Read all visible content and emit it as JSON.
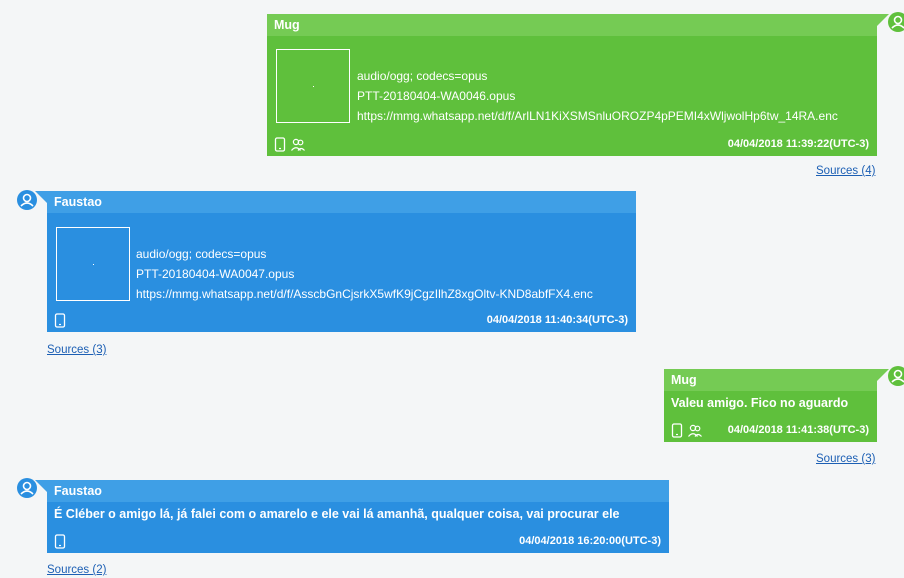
{
  "messages": [
    {
      "sender": "Mug",
      "mime": "audio/ogg; codecs=opus",
      "filename": "PTT-20180404-WA0046.opus",
      "url": "https://mmg.whatsapp.net/d/f/ArlLN1KiXSMSnluOROZP4pPEMI4xWljwolHp6tw_14RA.enc",
      "timestamp": "04/04/2018 11:39:22(UTC-3)",
      "sources": "Sources (4)"
    },
    {
      "sender": "Faustao",
      "mime": "audio/ogg; codecs=opus",
      "filename": "PTT-20180404-WA0047.opus",
      "url": "https://mmg.whatsapp.net/d/f/AsscbGnCjsrkX5wfK9jCgzIlhZ8xgOltv-KND8abfFX4.enc",
      "timestamp": "04/04/2018 11:40:34(UTC-3)",
      "sources": "Sources (3)"
    },
    {
      "sender": "Mug",
      "text": "Valeu amigo. Fico no aguardo",
      "timestamp": "04/04/2018 11:41:38(UTC-3)",
      "sources": "Sources (3)"
    },
    {
      "sender": "Faustao",
      "text": "É Cléber o amigo lá, já falei com o amarelo e ele vai lá amanhã, qualquer coisa, vai procurar ele",
      "timestamp": "04/04/2018 16:20:00(UTC-3)",
      "sources": "Sources (2)"
    }
  ],
  "icons": {
    "avatar": "user-avatar-icon",
    "device": "phone-icon",
    "group": "group-icon"
  },
  "colors": {
    "outgoing": "#5fc03c",
    "outgoing_header": "#75cb54",
    "incoming": "#2a8fe0",
    "incoming_header": "#3f9fe6",
    "link": "#1c5fb4"
  }
}
